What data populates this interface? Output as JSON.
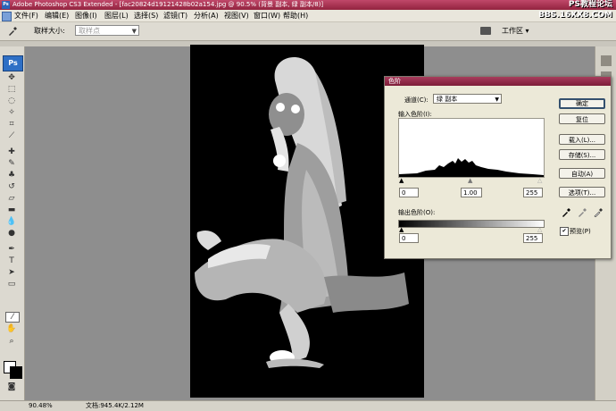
{
  "window": {
    "title": "Adobe Photoshop CS3 Extended - [fac20824d19121428b02a154.jpg @ 90.5% (背景 副本, 绿 副本/8)]",
    "watermark_top": "PS教程论坛",
    "watermark_bottom": "BBS.16XX8.COM"
  },
  "menu": {
    "items": [
      "文件(F)",
      "编辑(E)",
      "图像(I)",
      "图层(L)",
      "选择(S)",
      "滤镜(T)",
      "分析(A)",
      "视图(V)",
      "窗口(W)",
      "帮助(H)"
    ]
  },
  "options": {
    "sample_size_label": "取样大小:",
    "sample_size_value": "取样点",
    "workspace_label": "工作区 ▾"
  },
  "status": {
    "zoom": "90.48%",
    "doc": "文档:945.4K/2.12M"
  },
  "levels_dialog": {
    "title": "色阶",
    "channel_label": "通道(C):",
    "channel_value": "绿 副本",
    "input_levels_label": "输入色阶(I):",
    "input_black": "0",
    "input_gamma": "1.00",
    "input_white": "255",
    "output_levels_label": "输出色阶(O):",
    "output_black": "0",
    "output_white": "255",
    "buttons": {
      "ok": "确定",
      "reset": "复位",
      "load": "载入(L)...",
      "save": "存储(S)...",
      "auto": "自动(A)",
      "options": "选项(T)..."
    },
    "preview_label": "预览(P)",
    "preview_checked": true
  }
}
